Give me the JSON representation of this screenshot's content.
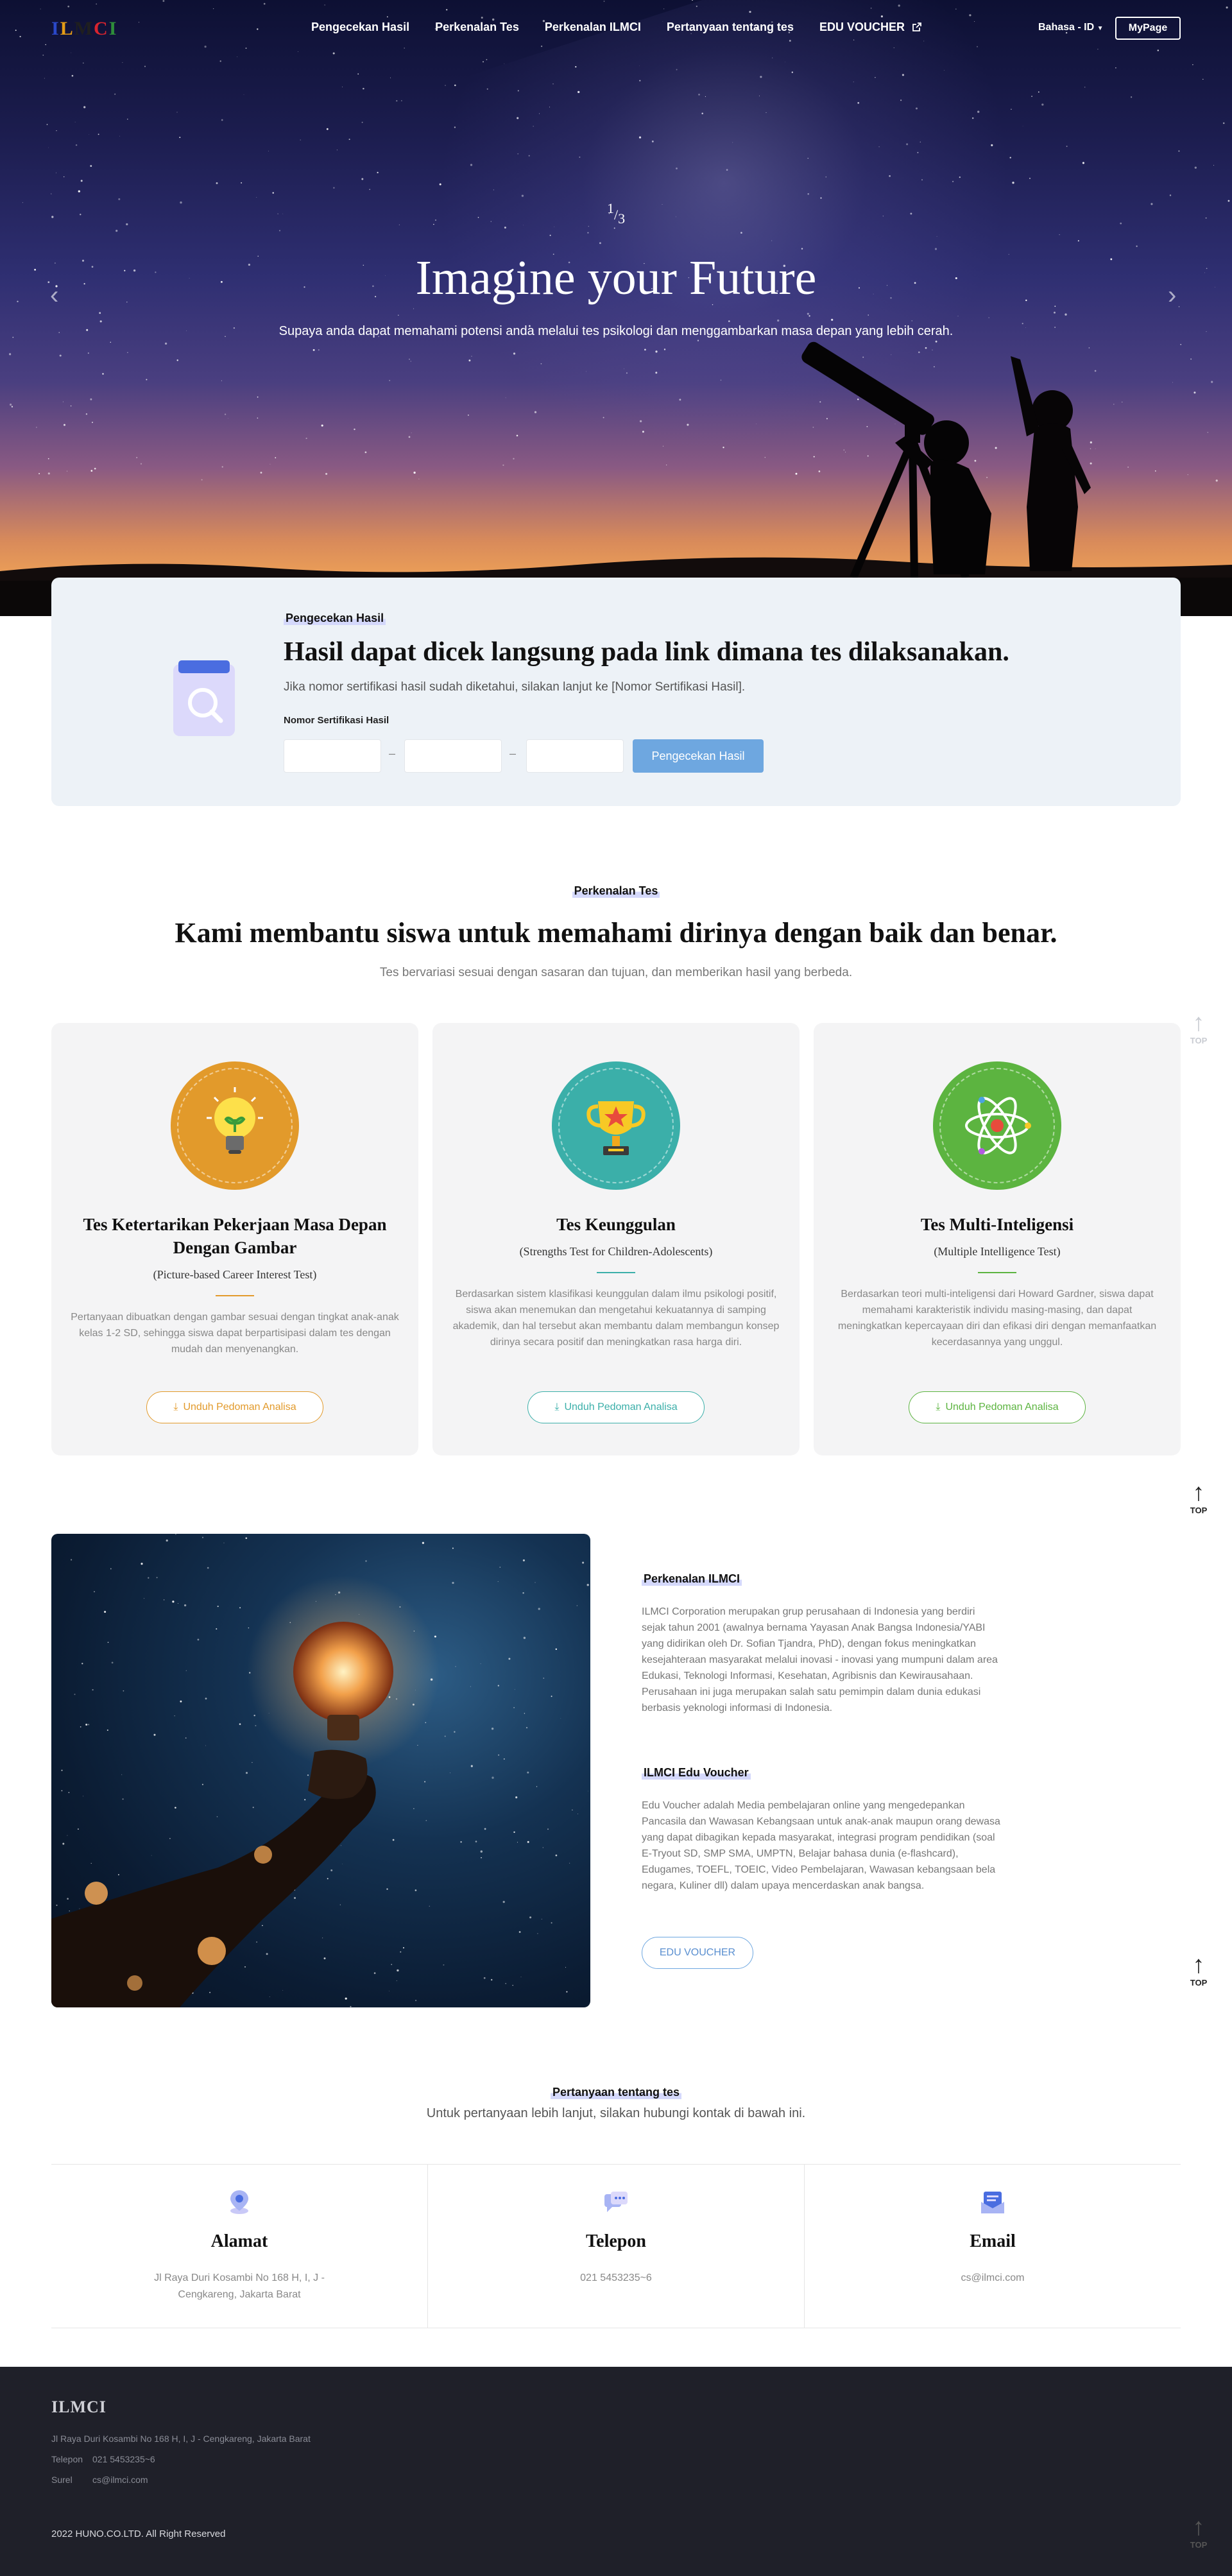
{
  "brand": {
    "logo_letters": [
      "I",
      "L",
      "M",
      "C",
      "I"
    ],
    "logo_colors": [
      "#2a48c8",
      "#e39b16",
      "#1f1f1f",
      "#d8242e",
      "#2e8e3a"
    ]
  },
  "nav": {
    "links": [
      "Pengecekan Hasil",
      "Perkenalan Tes",
      "Perkenalan ILMCI",
      "Pertanyaan tentang tes",
      "EDU VOUCHER"
    ],
    "language": "Bahasa - ID",
    "mypage": "MyPage"
  },
  "hero": {
    "slide_current": "1",
    "slide_sep": "/",
    "slide_total": "3",
    "title": "Imagine your Future",
    "subtitle": "Supaya anda dapat memahami potensi anda melalui tes psikologi dan menggambarkan masa depan yang lebih cerah."
  },
  "check": {
    "tag": "Pengecekan Hasil",
    "title": "Hasil dapat dicek langsung pada link dimana tes dilaksanakan.",
    "desc": "Jika nomor sertifikasi hasil sudah diketahui, silakan lanjut ke [Nomor Sertifikasi Hasil].",
    "label": "Nomor Sertifikasi Hasil",
    "separator": "–",
    "button": "Pengecekan Hasil",
    "accent": "#6ea7e0"
  },
  "intro": {
    "tag": "Perkenalan Tes",
    "title": "Kami membantu siswa untuk memahami dirinya dengan baik dan benar.",
    "subtitle": "Tes bervariasi sesuai dengan sasaran dan tujuan, dan memberikan hasil yang berbeda.",
    "cards": [
      {
        "title": "Tes Ketertarikan Pekerjaan Masa Depan Dengan Gambar",
        "subtitle": "(Picture-based Career Interest Test)",
        "desc": "Pertanyaan dibuatkan dengan gambar sesuai dengan tingkat anak-anak kelas 1-2 SD, sehingga siswa dapat berpartisipasi dalam tes dengan mudah dan menyenangkan.",
        "button": "Unduh Pedoman Analisa",
        "icon": "lightbulb-icon",
        "color": "#e29a2b"
      },
      {
        "title": "Tes Keunggulan",
        "subtitle": "(Strengths Test for Children-Adolescents)",
        "desc": "Berdasarkan sistem klasifikasi keunggulan dalam ilmu psikologi positif, siswa akan menemukan dan mengetahui kekuatannya di samping akademik, dan hal tersebut akan membantu dalam membangun konsep dirinya secara positif dan meningkatkan rasa harga diri.",
        "button": "Unduh Pedoman Analisa",
        "icon": "trophy-icon",
        "color": "#3bafa9"
      },
      {
        "title": "Tes Multi-Inteligensi",
        "subtitle": "(Multiple Intelligence Test)",
        "desc": "Berdasarkan teori multi-inteligensi dari Howard Gardner, siswa dapat memahami karakteristik individu masing-masing, dan dapat meningkatkan kepercayaan diri dan efikasi diri dengan memanfaatkan kecerdasannya yang unggul.",
        "button": "Unduh Pedoman Analisa",
        "icon": "atom-icon",
        "color": "#5cb440"
      }
    ]
  },
  "about": {
    "ilmci_tag": "Perkenalan ILMCI",
    "ilmci_text": "ILMCI Corporation merupakan grup perusahaan di Indonesia yang berdiri sejak tahun 2001 (awalnya bernama Yayasan Anak Bangsa Indonesia/YABI yang didirikan oleh Dr. Sofian Tjandra, PhD), dengan fokus meningkatkan kesejahteraan masyarakat melalui inovasi - inovasi yang mumpuni dalam area Edukasi, Teknologi Informasi, Kesehatan, Agribisnis dan Kewirausahaan. Perusahaan ini juga merupakan salah satu pemimpin dalam dunia edukasi berbasis yeknologi informasi di Indonesia.",
    "voucher_tag": "ILMCI Edu Voucher",
    "voucher_text": "Edu Voucher adalah Media pembelajaran online yang mengedepankan Pancasila dan Wawasan Kebangsaan untuk anak-anak maupun orang dewasa yang dapat dibagikan kepada masyarakat, integrasi program pendidikan (soal E-Tryout SD, SMP SMA, UMPTN, Belajar bahasa dunia (e-flashcard), Edugames, TOEFL, TOEIC, Video Pembelajaran, Wawasan kebangsaan bela negara, Kuliner dll) dalam upaya mencerdaskan anak bangsa.",
    "voucher_button": "EDU VOUCHER"
  },
  "contact": {
    "tag": "Pertanyaan tentang tes",
    "subtitle": "Untuk pertanyaan lebih lanjut, silakan hubungi kontak di bawah ini.",
    "items": [
      {
        "title": "Alamat",
        "line1": "Jl Raya Duri Kosambi No 168 H, I, J -",
        "line2": "Cengkareng, Jakarta Barat"
      },
      {
        "title": "Telepon",
        "line1": "021 5453235~6",
        "line2": ""
      },
      {
        "title": "Email",
        "line1": "cs@ilmci.com",
        "line2": ""
      }
    ]
  },
  "footer": {
    "logo": "ILMCI",
    "address": "Jl Raya Duri Kosambi No 168 H, I, J - Cengkareng, Jakarta Barat",
    "phone_label": "Telepon",
    "phone": "021 5453235~6",
    "email_label": "Surel",
    "email": "cs@ilmci.com",
    "copyright": "2022 HUNO.CO.LTD. All Right Reserved"
  },
  "top_label": "TOP"
}
